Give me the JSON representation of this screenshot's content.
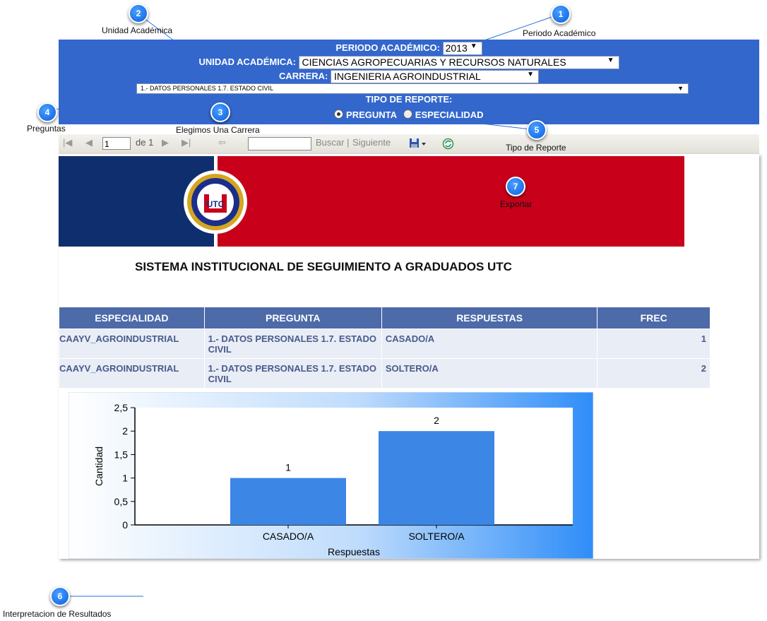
{
  "callouts": {
    "c1": {
      "num": "1",
      "label": "Periodo Académico"
    },
    "c2": {
      "num": "2",
      "label": "Unidad Académica"
    },
    "c3": {
      "num": "3",
      "label": "Elegimos Una Carrera"
    },
    "c4": {
      "num": "4",
      "label": "Preguntas"
    },
    "c5": {
      "num": "5",
      "label": "Tipo de Reporte"
    },
    "c6": {
      "num": "6",
      "label": "Interpretacion de Resultados"
    },
    "c7": {
      "num": "7",
      "label": "Exportar"
    }
  },
  "filters": {
    "periodo_label": "PERIODO ACADÉMICO:",
    "periodo_value": "2013",
    "unidad_label": "UNIDAD ACADÉMICA:",
    "unidad_value": "CIENCIAS AGROPECUARIAS Y RECURSOS NATURALES",
    "carrera_label": "CARRERA:",
    "carrera_value": "INGENIERIA AGROINDUSTRIAL",
    "pregunta_value": "1.- DATOS PERSONALES 1.7. ESTADO CIVIL",
    "tipo_label": "TIPO DE REPORTE:",
    "radio_pregunta": "PREGUNTA",
    "radio_especialidad": "ESPECIALIDAD"
  },
  "toolbar": {
    "page_input": "1",
    "page_of": "de 1",
    "search_placeholder": "",
    "buscar": "Buscar",
    "separator": "|",
    "siguiente": "Siguiente"
  },
  "report": {
    "title": "SISTEMA INSTITUCIONAL DE SEGUIMIENTO A GRADUADOS UTC",
    "logo_text": "UTC",
    "headers": [
      "ESPECIALIDAD",
      "PREGUNTA",
      "RESPUESTAS",
      "FREC"
    ],
    "rows": [
      [
        "CAAYV_AGROINDUSTRIAL",
        "1.- DATOS PERSONALES 1.7. ESTADO CIVIL",
        "CASADO/A",
        "1"
      ],
      [
        "CAAYV_AGROINDUSTRIAL",
        "1.- DATOS PERSONALES 1.7. ESTADO CIVIL",
        "SOLTERO/A",
        "2"
      ]
    ]
  },
  "colors": {
    "panel": "#3367cc",
    "banner_blue": "#0f2e6e",
    "banner_red": "#c8001a",
    "bar": "#3c86e6"
  },
  "chart_data": {
    "type": "bar",
    "categories": [
      "CASADO/A",
      "SOLTERO/A"
    ],
    "values": [
      1,
      2
    ],
    "data_labels": [
      "1",
      "2"
    ],
    "xlabel": "Respuestas",
    "ylabel": "Cantidad",
    "ylim": [
      0,
      2.5
    ],
    "yticks": [
      "0",
      "0,5",
      "1",
      "1,5",
      "2",
      "2,5"
    ],
    "grid": false
  }
}
